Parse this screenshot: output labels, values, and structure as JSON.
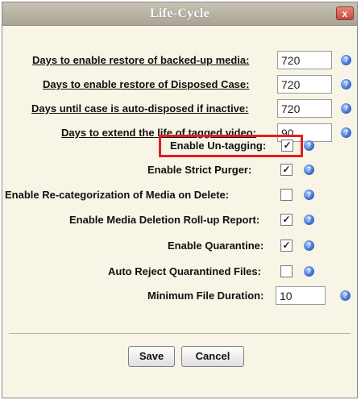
{
  "dialog": {
    "title": "Life-Cycle",
    "close_label": "x"
  },
  "fields": {
    "restore_backup": {
      "label": "Days to enable restore of backed-up media:",
      "value": "720"
    },
    "restore_disposed": {
      "label": "Days to enable restore of Disposed Case:",
      "value": "720"
    },
    "auto_dispose": {
      "label": "Days until case is auto-disposed if inactive:",
      "value": "720"
    },
    "extend_tagged": {
      "label": "Days to extend the life of tagged video:",
      "value": "90"
    },
    "untagging": {
      "label": "Enable Un-tagging:",
      "checked": true
    },
    "strict_purger": {
      "label": "Enable Strict Purger:",
      "checked": true
    },
    "recategorization": {
      "label": "Enable Re-categorization of Media on Delete:",
      "checked": false
    },
    "rollup_report": {
      "label": "Enable Media Deletion Roll-up Report:",
      "checked": true
    },
    "quarantine": {
      "label": "Enable Quarantine:",
      "checked": true
    },
    "auto_reject": {
      "label": "Auto Reject Quarantined Files:",
      "checked": false
    },
    "min_duration": {
      "label": "Minimum File Duration:",
      "value": "10"
    }
  },
  "check_glyph": "✓",
  "help_glyph": "?",
  "buttons": {
    "save": "Save",
    "cancel": "Cancel"
  },
  "colors": {
    "highlight": "#e02020",
    "help_icon": "#3565c8"
  }
}
